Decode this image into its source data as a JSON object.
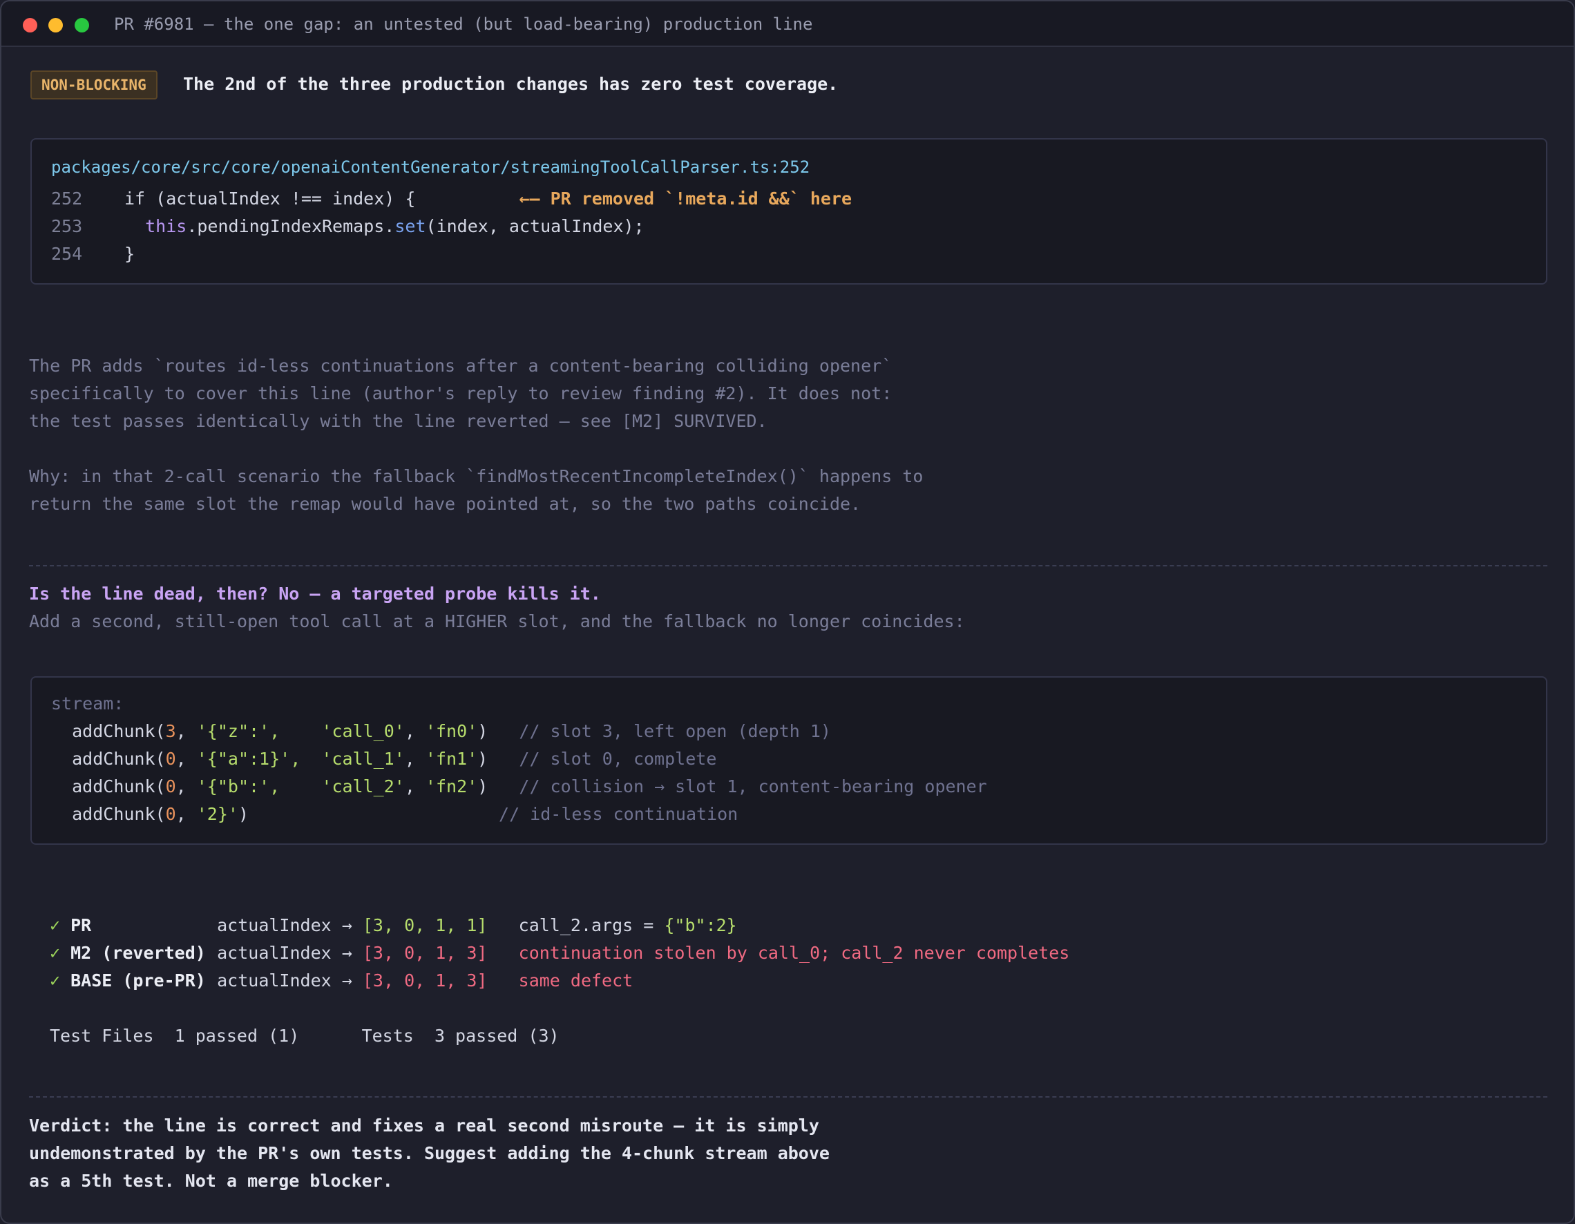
{
  "window": {
    "title": "PR #6981 — the one gap: an untested (but load-bearing) production line"
  },
  "header": {
    "badge": "NON-BLOCKING",
    "headline": "The 2nd of the three production changes has zero test coverage."
  },
  "code_excerpt": {
    "file": "packages/core/src/core/openaiContentGenerator/streamingToolCallParser.ts:252",
    "lines": [
      {
        "num": "252",
        "pre": "if (actualIndex !== index) {",
        "annotation": "←— PR removed `!meta.id &&` here"
      },
      {
        "num": "253",
        "this": "this",
        "mid1": ".pendingIndexRemaps.",
        "call": "set",
        "rest": "(index, actualIndex);"
      },
      {
        "num": "254",
        "pre": "}"
      }
    ]
  },
  "explanation": {
    "p1": [
      "The PR adds `routes id-less continuations after a content-bearing colliding opener`",
      "specifically to cover this line (author's reply to review finding #2). It does not:",
      "the test passes identically with the line reverted — see [M2] SURVIVED."
    ],
    "p2": [
      "Why: in that 2-call scenario the fallback `findMostRecentIncompleteIndex()` happens to",
      "return the same slot the remap would have pointed at, so the two paths coincide."
    ]
  },
  "probe": {
    "heading": "Is the line dead, then? No — a targeted probe kills it.",
    "subtext": "Add a second, still-open tool call at a HIGHER slot, and the fallback no longer coincides:"
  },
  "stream": {
    "label": "stream:",
    "chunks": [
      {
        "fn": "addChunk(",
        "idx": "3",
        "args": "'{\"z\":',",
        "pad": "    ",
        "id": "'call_0'",
        "name": "'fn0'",
        "comment": "// slot 3, left open (depth 1)"
      },
      {
        "fn": "addChunk(",
        "idx": "0",
        "args": "'{\"a\":1}',",
        "pad": "  ",
        "id": "'call_1'",
        "name": "'fn1'",
        "comment": "// slot 0, complete"
      },
      {
        "fn": "addChunk(",
        "idx": "0",
        "args": "'{\"b\":',",
        "pad": "    ",
        "id": "'call_2'",
        "name": "'fn2'",
        "comment": "// collision → slot 1, content-bearing opener"
      },
      {
        "fn": "addChunk(",
        "idx": "0",
        "args": "'2}'",
        "comment": "// id-less continuation"
      }
    ]
  },
  "results": [
    {
      "check": "✓",
      "label": "PR",
      "metric": "actualIndex →",
      "indices": "[3, 0, 1, 1]",
      "note": "call_2.args = ",
      "note_value": "{\"b\":2}",
      "status": "ok"
    },
    {
      "check": "✓",
      "label": "M2 (reverted)",
      "metric": "actualIndex →",
      "indices": "[3, 0, 1, 3]",
      "note": "continuation stolen by call_0; call_2 never completes",
      "status": "bad"
    },
    {
      "check": "✓",
      "label": "BASE (pre-PR)",
      "metric": "actualIndex →",
      "indices": "[3, 0, 1, 3]",
      "note": "same defect",
      "status": "bad"
    }
  ],
  "summary": {
    "files_label": "Test Files",
    "files_value": "1 passed (1)",
    "tests_label": "Tests",
    "tests_value": "3 passed (3)"
  },
  "verdict": [
    "Verdict: the line is correct and fixes a real second misroute — it is simply",
    "undemonstrated by the PR's own tests. Suggest adding the 4-chunk stream above",
    "as a 5th test. Not a merge blocker."
  ],
  "colors": {
    "background": "#1e1f2b",
    "badge": "#e8b46a",
    "accent_purple": "#c9a4f4",
    "ok_green": "#b6dc6c",
    "error_red": "#f06a82",
    "path_blue": "#7cc7ea"
  }
}
